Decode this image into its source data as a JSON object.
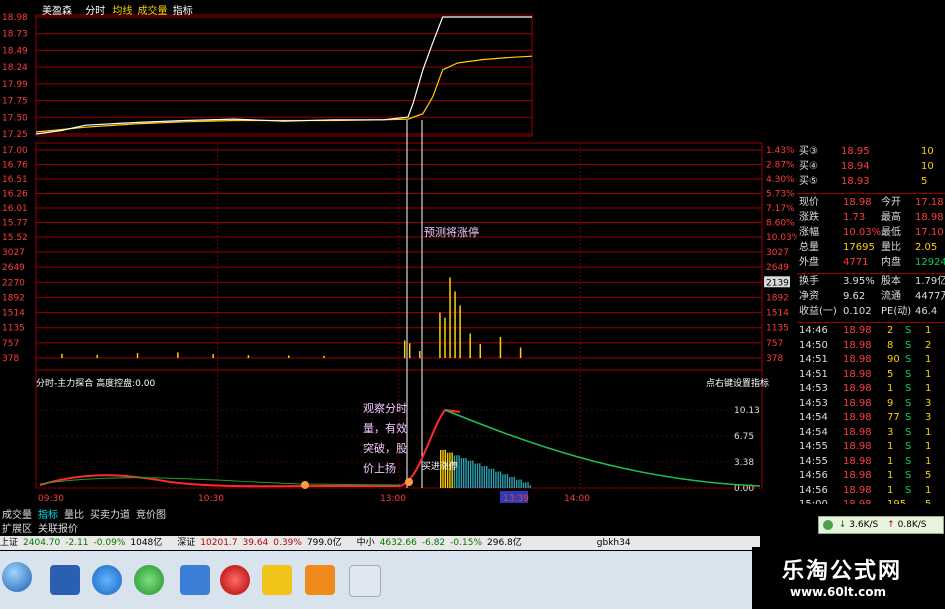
{
  "header": {
    "app": "美盈森",
    "label_fenshi": "分时",
    "label_junxian": "均线",
    "label_chengjiaoliang": "成交量",
    "label_zhibiao": "指标"
  },
  "chart_data": {
    "type": "line",
    "price_axis_top": [
      "18.98",
      "18.73",
      "18.49",
      "18.24",
      "17.99",
      "17.75",
      "17.50",
      "17.25"
    ],
    "price_axis_main": [
      "17.00",
      "16.76",
      "16.51",
      "16.26",
      "16.01",
      "15.77",
      "15.52"
    ],
    "pct_axis": [
      "1.43%",
      "2.87%",
      "4.30%",
      "5.73%",
      "7.17%",
      "8.60%",
      "10.03%"
    ],
    "vol_axis_left": [
      "3027",
      "2649",
      "2270",
      "1892",
      "1514",
      "1135",
      "757",
      "378"
    ],
    "vol_axis_right": [
      "3027",
      "2649",
      "2139",
      "1892",
      "1514",
      "1135",
      "757",
      "378"
    ],
    "vol_highlight": "2139",
    "ind_axis": [
      "10.13",
      "6.75",
      "3.38",
      "0.00"
    ],
    "time_labels": [
      "09:30",
      "10:30",
      "13:00",
      "13:39",
      "14:00"
    ],
    "price_series": {
      "name": "",
      "x": [
        0,
        0.05,
        0.1,
        0.2,
        0.3,
        0.4,
        0.5,
        0.6,
        0.7,
        0.75,
        0.76,
        0.78,
        0.8,
        0.82,
        0.83,
        0.85,
        0.9,
        1.0
      ],
      "y": [
        17.25,
        17.3,
        17.38,
        17.42,
        17.45,
        17.47,
        17.44,
        17.46,
        17.46,
        17.5,
        17.7,
        18.2,
        18.6,
        18.98,
        18.98,
        18.98,
        18.98,
        18.98
      ]
    },
    "avg_series": {
      "name": "",
      "x": [
        0,
        0.1,
        0.2,
        0.3,
        0.4,
        0.5,
        0.6,
        0.7,
        0.75,
        0.78,
        0.8,
        0.82,
        0.85,
        0.9,
        0.95,
        1.0
      ],
      "y": [
        17.28,
        17.35,
        17.4,
        17.43,
        17.45,
        17.45,
        17.45,
        17.46,
        17.47,
        17.55,
        17.8,
        18.2,
        18.3,
        18.35,
        18.38,
        18.4
      ]
    },
    "volume_bars": [
      {
        "x": 0.05,
        "v": 120
      },
      {
        "x": 0.12,
        "v": 90
      },
      {
        "x": 0.2,
        "v": 140
      },
      {
        "x": 0.28,
        "v": 160
      },
      {
        "x": 0.35,
        "v": 110
      },
      {
        "x": 0.42,
        "v": 80
      },
      {
        "x": 0.5,
        "v": 70
      },
      {
        "x": 0.57,
        "v": 60
      },
      {
        "x": 0.73,
        "v": 500
      },
      {
        "x": 0.74,
        "v": 420
      },
      {
        "x": 0.76,
        "v": 200
      },
      {
        "x": 0.8,
        "v": 1300
      },
      {
        "x": 0.81,
        "v": 1150
      },
      {
        "x": 0.82,
        "v": 2300
      },
      {
        "x": 0.83,
        "v": 1900
      },
      {
        "x": 0.84,
        "v": 1500
      },
      {
        "x": 0.86,
        "v": 700
      },
      {
        "x": 0.88,
        "v": 400
      },
      {
        "x": 0.92,
        "v": 600
      },
      {
        "x": 0.96,
        "v": 300
      }
    ],
    "indicator_title": "分时-主力探合  高度控盘:0.00",
    "indicator_note": "点右键设置指标"
  },
  "annotations": {
    "forecast": "预测将涨停",
    "observe": "观察分时量，有效突破，股价上扬",
    "buy_signal": "买进涨停"
  },
  "right_panel": {
    "bids": [
      {
        "label": "买③",
        "price": "18.95",
        "vol": "10"
      },
      {
        "label": "买④",
        "price": "18.94",
        "vol": "10"
      },
      {
        "label": "买⑤",
        "price": "18.93",
        "vol": "5"
      }
    ],
    "quote": [
      {
        "k1": "现价",
        "v1": "18.98",
        "k2": "今开",
        "v2": "17.18"
      },
      {
        "k1": "涨跌",
        "v1": "1.73",
        "k2": "最高",
        "v2": "18.98"
      },
      {
        "k1": "涨幅",
        "v1": "10.03%",
        "k2": "最低",
        "v2": "17.10"
      },
      {
        "k1": "总量",
        "v1": "17695",
        "k2": "量比",
        "v2": "2.05"
      },
      {
        "k1": "外盘",
        "v1": "4771",
        "k2": "内盘",
        "v2": "12924"
      }
    ],
    "stats": [
      {
        "k1": "换手",
        "v1": "3.95%",
        "k2": "股本",
        "v2": "1.79亿"
      },
      {
        "k1": "净资",
        "v1": "9.62",
        "k2": "流通",
        "v2": "4477万"
      },
      {
        "k1": "收益(一)",
        "v1": "0.102",
        "k2": "PE(动)",
        "v2": "46.4"
      }
    ],
    "ticks": [
      {
        "t": "14:46",
        "p": "18.98",
        "v": "2",
        "s": "S",
        "n": "1"
      },
      {
        "t": "14:50",
        "p": "18.98",
        "v": "8",
        "s": "S",
        "n": "2"
      },
      {
        "t": "14:51",
        "p": "18.98",
        "v": "90",
        "s": "S",
        "n": "1"
      },
      {
        "t": "14:51",
        "p": "18.98",
        "v": "5",
        "s": "S",
        "n": "1"
      },
      {
        "t": "14:53",
        "p": "18.98",
        "v": "1",
        "s": "S",
        "n": "1"
      },
      {
        "t": "14:53",
        "p": "18.98",
        "v": "9",
        "s": "S",
        "n": "3"
      },
      {
        "t": "14:54",
        "p": "18.98",
        "v": "77",
        "s": "S",
        "n": "3"
      },
      {
        "t": "14:54",
        "p": "18.98",
        "v": "3",
        "s": "S",
        "n": "1"
      },
      {
        "t": "14:55",
        "p": "18.98",
        "v": "1",
        "s": "S",
        "n": "1"
      },
      {
        "t": "14:55",
        "p": "18.98",
        "v": "1",
        "s": "S",
        "n": "1"
      },
      {
        "t": "14:56",
        "p": "18.98",
        "v": "1",
        "s": "S",
        "n": "5"
      },
      {
        "t": "14:56",
        "p": "18.98",
        "v": "1",
        "s": "S",
        "n": "1"
      },
      {
        "t": "15:00",
        "p": "18.98",
        "v": "195",
        "s": "",
        "n": "5"
      }
    ]
  },
  "bottom_tabs": [
    "成交量",
    "指标",
    "量比",
    "买卖力道",
    "竞价图"
  ],
  "bottom_tabs2": [
    "扩展区",
    "关联报价"
  ],
  "index_bar": [
    {
      "name": "上证",
      "value": "2404.70",
      "chg": "-2.11",
      "pct": "-0.09%",
      "amt": "1048亿"
    },
    {
      "name": "深证",
      "value": "10201.7",
      "chg": "39.64",
      "pct": "0.39%",
      "amt": "799.0亿"
    },
    {
      "name": "中小",
      "value": "4632.66",
      "chg": "-6.82",
      "pct": "-0.15%",
      "amt": "296.8亿"
    }
  ],
  "index_extra": "gbkh34",
  "net_speed": {
    "down": "3.6K/S",
    "up": "0.8K/S"
  },
  "watermark": {
    "title": "乐淘公式网",
    "url": "www.60lt.com"
  },
  "colors": {
    "red": "#ff3b3b",
    "grid": "#9a0000",
    "yellow": "#ffd000",
    "green": "#00d060"
  }
}
